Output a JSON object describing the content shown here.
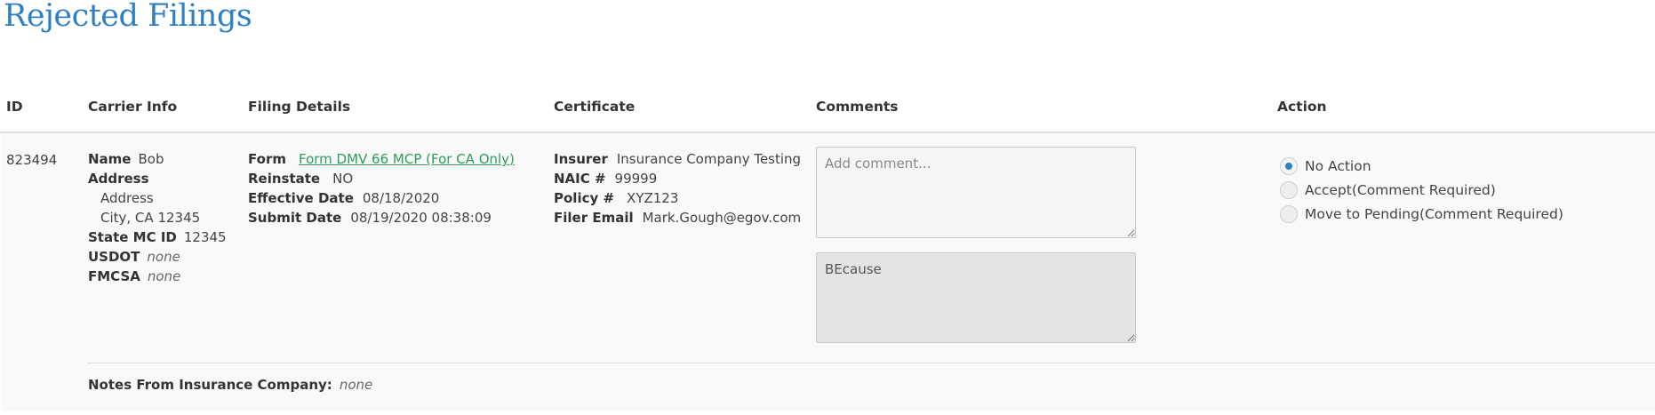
{
  "page": {
    "title": "Rejected Filings"
  },
  "columns": {
    "id": "ID",
    "carrier_info": "Carrier Info",
    "filing_details": "Filing Details",
    "certificate": "Certificate",
    "comments": "Comments",
    "action": "Action"
  },
  "filing": {
    "id": "823494",
    "carrier": {
      "name_label": "Name",
      "name": "Bob",
      "address_label": "Address",
      "address_line1": "Address",
      "address_line2": "City, CA 12345",
      "state_mc_id_label": "State MC ID",
      "state_mc_id": "12345",
      "usdot_label": "USDOT",
      "usdot": "none",
      "fmcsa_label": "FMCSA",
      "fmcsa": "none"
    },
    "details": {
      "form_label": "Form",
      "form_link": "Form DMV 66 MCP (For CA Only)",
      "reinstate_label": "Reinstate",
      "reinstate": "NO",
      "effective_date_label": "Effective Date",
      "effective_date": "08/18/2020",
      "submit_date_label": "Submit Date",
      "submit_date": "08/19/2020 08:38:09"
    },
    "certificate": {
      "insurer_label": "Insurer",
      "insurer": "Insurance Company Testing",
      "naic_label": "NAIC #",
      "naic": "99999",
      "policy_label": "Policy #",
      "policy": "XYZ123",
      "filer_email_label": "Filer Email",
      "filer_email": "Mark.Gough@egov.com"
    },
    "comments": {
      "new_placeholder": "Add comment...",
      "new_value": "",
      "previous_value": "BEcause"
    },
    "action": {
      "options": [
        "No Action",
        "Accept(Comment Required)",
        "Move to Pending(Comment Required)"
      ],
      "selected": "No Action"
    },
    "notes_label": "Notes From Insurance Company:",
    "notes_value": "none"
  },
  "colors": {
    "title": "#2f7fc4",
    "link": "#2e9c5d",
    "radio_selected": "#2f7fc4",
    "row_background": "#f9f9f9"
  }
}
